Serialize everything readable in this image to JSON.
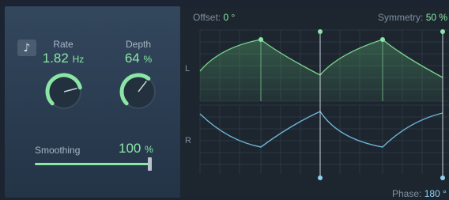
{
  "left": {
    "note_icon": "♪",
    "rate": {
      "label": "Rate",
      "value": "1.82",
      "unit": "Hz",
      "level": 0.78
    },
    "depth": {
      "label": "Depth",
      "value": "64",
      "unit": "%",
      "level": 0.64
    },
    "smoothing": {
      "label": "Smoothing",
      "value": "100",
      "unit": "%",
      "level": 1.0
    }
  },
  "right": {
    "offset": {
      "label": "Offset:",
      "value": "0 °"
    },
    "symmetry": {
      "label": "Symmetry:",
      "value": "50 %"
    },
    "phase": {
      "label": "Phase:",
      "value": "180 °"
    },
    "channel_left": "L",
    "channel_right": "R"
  },
  "colors": {
    "accent_green": "#8be6a6",
    "accent_blue": "#8fd3f3",
    "left_curve": "#7ad08d",
    "right_curve": "#6fb6d9"
  }
}
